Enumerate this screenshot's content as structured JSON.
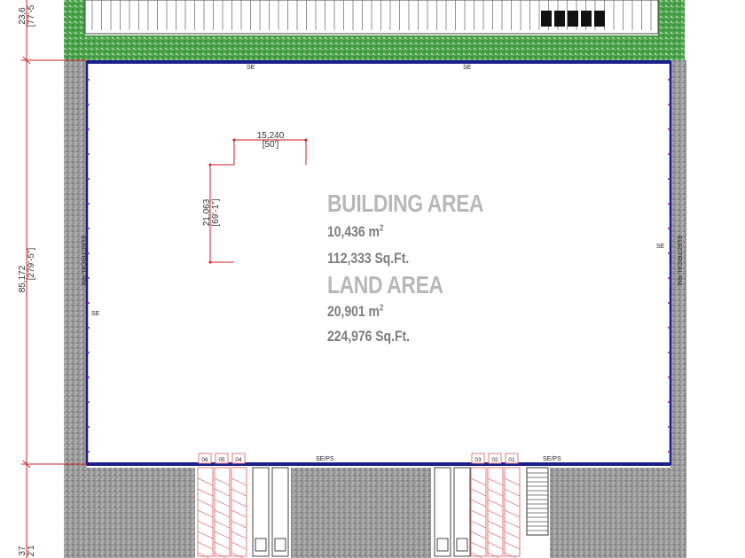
{
  "building_area": {
    "title": "BUILDING AREA",
    "metric": "10,436 m",
    "metric_sup": "2",
    "imperial": "112,333 Sq.Ft."
  },
  "land_area": {
    "title": "LAND AREA",
    "metric": "20,901 m",
    "metric_sup": "2",
    "imperial": "224,976 Sq.Ft."
  },
  "dimensions": {
    "bay_width_m": "15,240",
    "bay_width_ft": "[50']",
    "bay_depth_m": "21,063",
    "bay_depth_ft": "[69'-1\"]",
    "overall_depth_m": "85,172",
    "overall_depth_ft": "[279'-5\"]",
    "top_dim_m": "23,6",
    "top_dim_ft": "[77'-5",
    "bottom_dim_m": "37",
    "bottom_dim_ft": "2'1"
  },
  "labels": {
    "se": "SE",
    "se_ps": "SE/PS",
    "electrical_room": "ELECTRICAL RM."
  },
  "dock_doors": {
    "left": [
      "06",
      "05",
      "04"
    ],
    "right": [
      "03",
      "02",
      "01"
    ]
  },
  "colors": {
    "wall": "#1a1f8c",
    "grass": "#3d9a3d",
    "paving": "#8c8c8c",
    "dim_line": "#cc2222",
    "parking_stall": "#e07a7a",
    "area_title": "#b8b8b8",
    "area_value": "#7d7d7d"
  }
}
